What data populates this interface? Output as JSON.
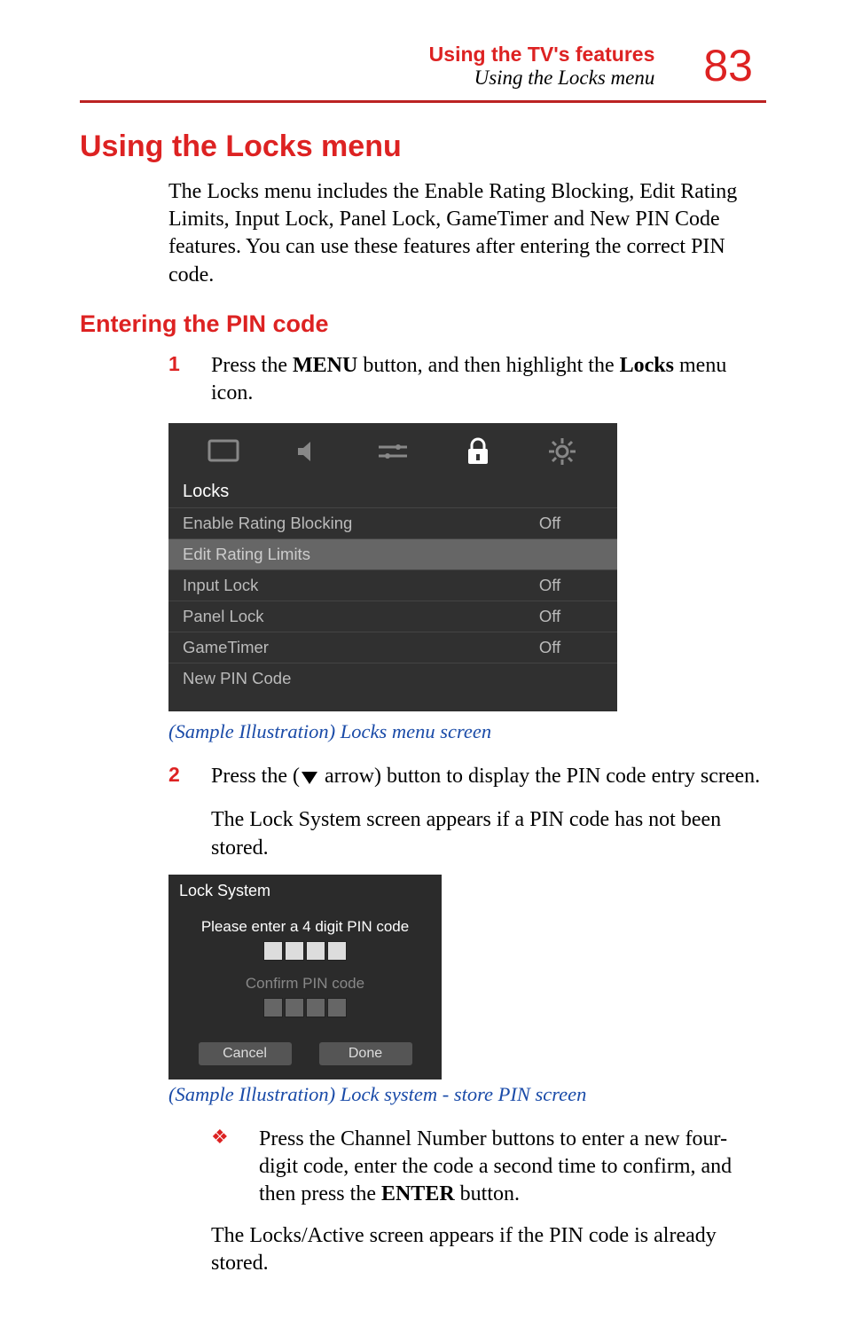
{
  "page": {
    "header_title": "Using the TV's features",
    "header_subtitle": "Using the Locks menu",
    "number": "83"
  },
  "h1": "Using the Locks menu",
  "intro": "The Locks menu includes the Enable Rating Blocking, Edit Rating Limits, Input Lock, Panel Lock, GameTimer and New PIN Code features. You can use these features after entering the correct PIN code.",
  "h2": "Entering the PIN code",
  "step1": {
    "num": "1",
    "pre": "Press the ",
    "bold1": "MENU",
    "mid": " button, and then highlight the ",
    "bold2": "Locks",
    "post": " menu icon."
  },
  "locks_menu": {
    "title": "Locks",
    "rows": [
      {
        "label": "Enable Rating Blocking",
        "value": "Off"
      },
      {
        "label": "Edit Rating Limits",
        "value": ""
      },
      {
        "label": "Input Lock",
        "value": "Off"
      },
      {
        "label": "Panel Lock",
        "value": "Off"
      },
      {
        "label": "GameTimer",
        "value": "Off"
      },
      {
        "label": "New PIN Code",
        "value": ""
      }
    ]
  },
  "caption1": "(Sample Illustration) Locks menu screen",
  "step2": {
    "num": "2",
    "pre": "Press the (",
    "post": " arrow) button to display the PIN code entry screen."
  },
  "step2_cont": "The Lock System screen appears if a PIN code has not been stored.",
  "lock_system": {
    "title": "Lock System",
    "enter_label": "Please enter a 4 digit PIN code",
    "confirm_label": "Confirm PIN code",
    "cancel": "Cancel",
    "done": "Done"
  },
  "caption2": "(Sample Illustration) Lock system - store PIN screen",
  "bullet": {
    "pre": "Press the Channel Number buttons to enter a new four-digit code, enter the code a second time to confirm, and then press the ",
    "bold": "ENTER",
    "post": " button."
  },
  "final": "The Locks/Active screen appears if the PIN code is already stored."
}
